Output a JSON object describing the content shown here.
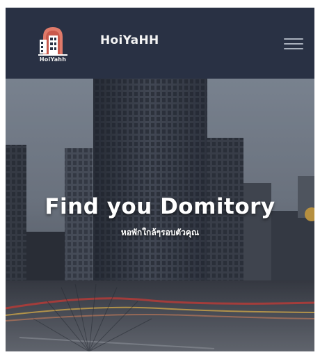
{
  "navbar": {
    "logo_text": "HoiYahh",
    "brand": "HoiYaHH",
    "menu_icon": "hamburger-menu-icon"
  },
  "hero": {
    "title": "Find you Domitory",
    "subtitle": "หอพักใกล้ๆรอบตัวคุณ"
  },
  "colors": {
    "navbar_bg": "#293144",
    "logo_accent": "#e07a6a",
    "text": "#ffffff"
  }
}
